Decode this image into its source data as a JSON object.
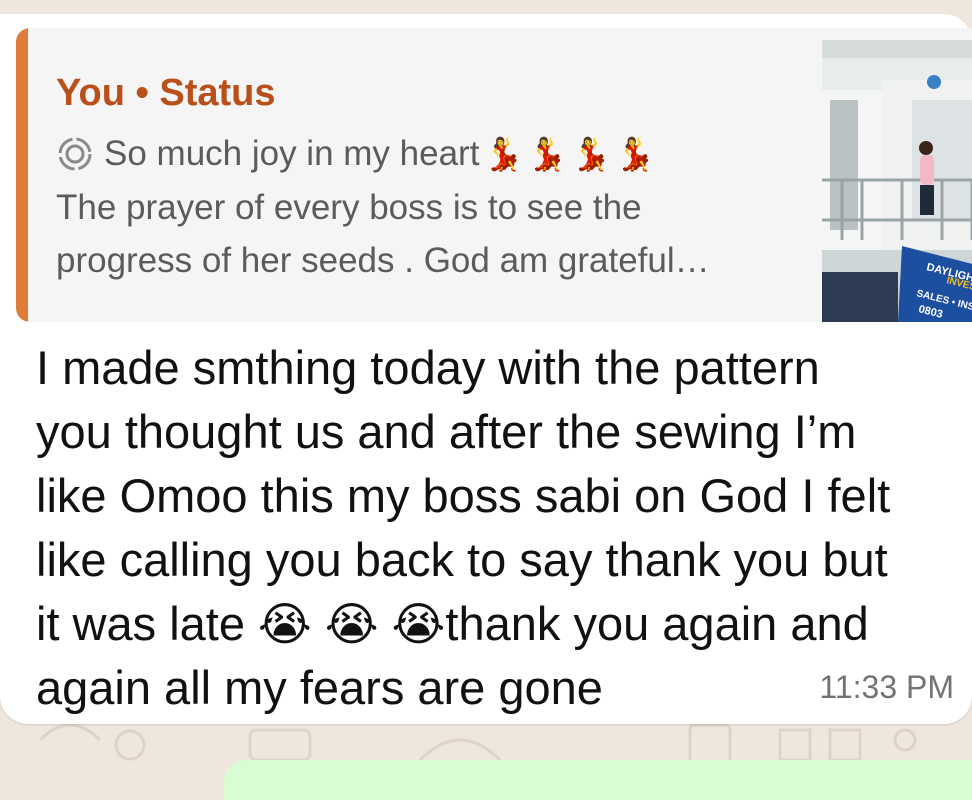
{
  "quote": {
    "header": "You • Status",
    "line1": "So much joy in my heart",
    "dancers": [
      "💃",
      "💃",
      "💃",
      "💃"
    ],
    "line2": "The prayer of every boss is to see the",
    "line3": "progress of her seeds . God am grateful…",
    "accent_color": "#e07b39",
    "header_color": "#b9501c",
    "icon": "status-ring-icon"
  },
  "message": {
    "lines": [
      "I made smthing today with the pattern",
      "you thought us and after the sewing I’m",
      "like Omoo this my boss sabi on God I felt",
      "like calling you back to say thank you but"
    ],
    "line5_start": "it was late ",
    "emojis": [
      "😭",
      "😭",
      "😭"
    ],
    "line5_end": "thank you again and",
    "line6": "again all my fears are gone"
  },
  "time": "11:33 PM",
  "thumbnail": {
    "sign_line1": "DAYLIGHT PE",
    "sign_line2": "INVESTMEN",
    "sign_line3": "SALES • INSTALLATIO",
    "sign_line4": "0803"
  }
}
